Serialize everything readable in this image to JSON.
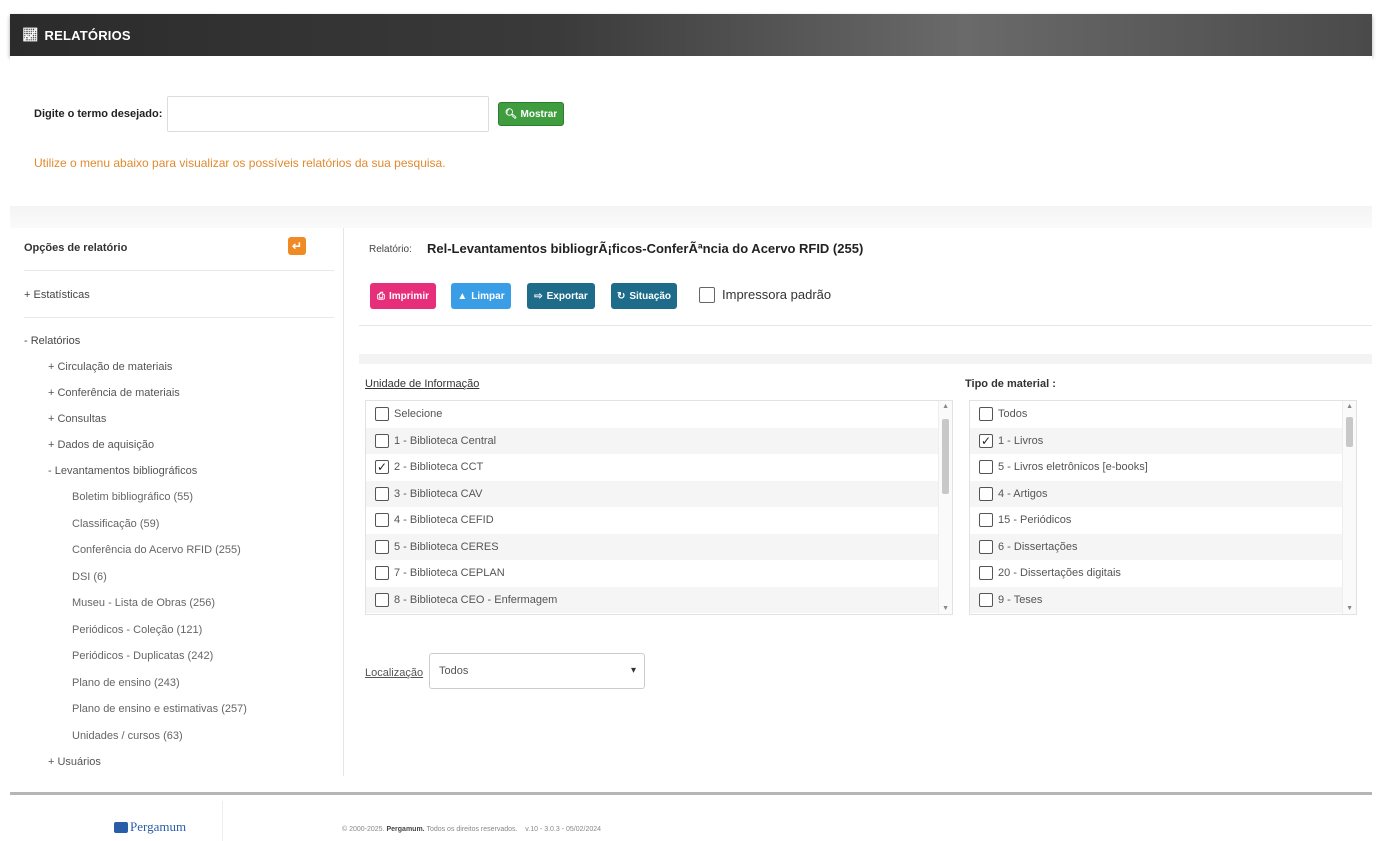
{
  "header": {
    "title": "RELATÓRIOS"
  },
  "search": {
    "label": "Digite o termo desejado:",
    "value": "",
    "placeholder": "",
    "button_label": "Mostrar",
    "hint": "Utilize o menu abaixo para visualizar os possíveis relatórios da sua pesquisa."
  },
  "sidebar": {
    "heading": "Opções de relatório",
    "estatisticas": "+ Estatísticas",
    "relatorios": "- Relatórios",
    "groups": [
      "+ Circulação de materiais",
      "+ Conferência de materiais",
      "+ Consultas",
      "+ Dados de aquisição",
      "- Levantamentos bibliográficos"
    ],
    "leaves": [
      "Boletim bibliográfico (55)",
      "Classificação (59)",
      "Conferência do Acervo RFID (255)",
      "DSI (6)",
      "Museu - Lista de Obras (256)",
      "Periódicos - Coleção (121)",
      "Periódicos - Duplicatas (242)",
      "Plano de ensino (243)",
      "Plano de ensino e estimativas (257)",
      "Unidades / cursos (63)"
    ],
    "usuarios": "+ Usuários"
  },
  "report": {
    "label": "Relatório:",
    "title": "Rel-Levantamentos bibliogrÃ¡ficos-ConferÃªncia do Acervo RFID (255)",
    "buttons": {
      "imprimir": "Imprimir",
      "limpar": "Limpar",
      "exportar": "Exportar",
      "situacao": "Situação"
    },
    "printer_label": "Impressora padrão",
    "printer_checked": false
  },
  "unidade": {
    "title": "Unidade de Informação",
    "items": [
      {
        "label": "Selecione",
        "checked": false
      },
      {
        "label": "1 - Biblioteca Central",
        "checked": false
      },
      {
        "label": "2 - Biblioteca CCT",
        "checked": true
      },
      {
        "label": "3 - Biblioteca CAV",
        "checked": false
      },
      {
        "label": "4 - Biblioteca CEFID",
        "checked": false
      },
      {
        "label": "5 - Biblioteca CERES",
        "checked": false
      },
      {
        "label": "7 - Biblioteca CEPLAN",
        "checked": false
      },
      {
        "label": "8 - Biblioteca CEO - Enfermagem",
        "checked": false
      }
    ]
  },
  "tipo": {
    "title": "Tipo de material :",
    "items": [
      {
        "label": "Todos",
        "checked": false
      },
      {
        "label": "1 - Livros",
        "checked": true
      },
      {
        "label": "5 - Livros eletrônicos [e-books]",
        "checked": false
      },
      {
        "label": "4 - Artigos",
        "checked": false
      },
      {
        "label": "15 - Periódicos",
        "checked": false
      },
      {
        "label": "6 - Dissertações",
        "checked": false
      },
      {
        "label": "20 - Dissertações digitais",
        "checked": false
      },
      {
        "label": "9 - Teses",
        "checked": false
      }
    ]
  },
  "localizacao": {
    "label": "Localização",
    "value": "Todos"
  },
  "footer": {
    "logo": "Pergamum",
    "copyright_prefix": "© 2000-2025.",
    "copyright_brand": "Pergamum.",
    "copyright_rest": "Todos os direitos reservados.",
    "version": "v.10 - 3.0.3 - 05/02/2024"
  }
}
